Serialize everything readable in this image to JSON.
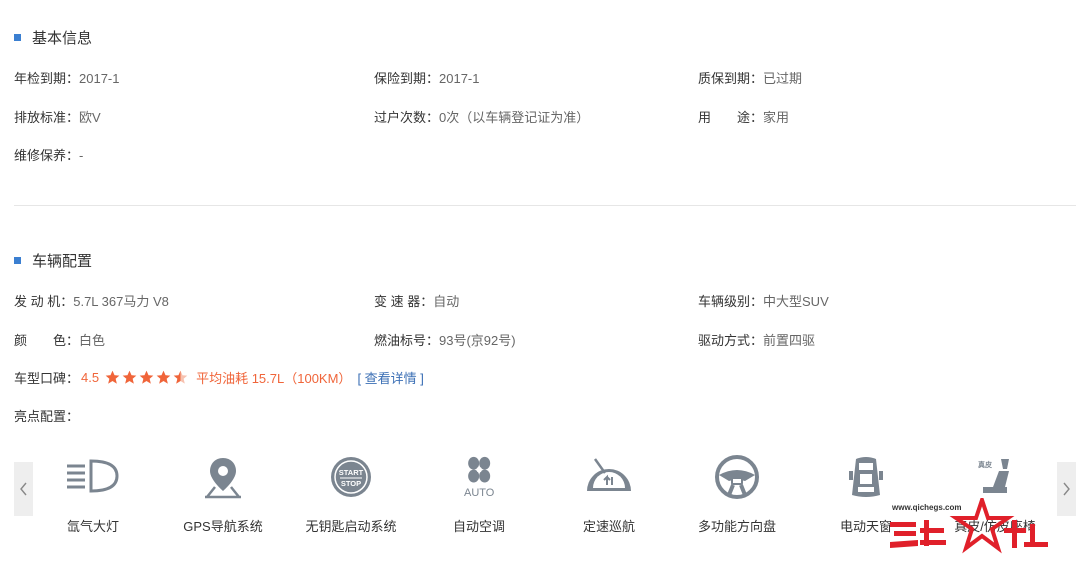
{
  "basic_info": {
    "title": "基本信息",
    "rows": [
      [
        {
          "label": "年检到期：",
          "value": "2017-1"
        },
        {
          "label": "保险到期：",
          "value": "2017-1"
        },
        {
          "label": "质保到期：",
          "value": "已过期"
        }
      ],
      [
        {
          "label": "排放标准：",
          "value": "欧V"
        },
        {
          "label": "过户次数：",
          "value": "0次（以车辆登记证为准）"
        },
        {
          "label": "用　　途：",
          "value": "家用"
        }
      ],
      [
        {
          "label": "维修保养：",
          "value": "-"
        }
      ]
    ]
  },
  "vehicle_config": {
    "title": "车辆配置",
    "rows": [
      [
        {
          "label": "发 动 机：",
          "value": "5.7L 367马力 V8"
        },
        {
          "label": "变 速 器：",
          "value": "自动"
        },
        {
          "label": "车辆级别：",
          "value": "中大型SUV"
        }
      ],
      [
        {
          "label": "颜　　色：",
          "value": "白色"
        },
        {
          "label": "燃油标号：",
          "value": "93号(京92号)"
        },
        {
          "label": "驱动方式：",
          "value": "前置四驱"
        }
      ]
    ],
    "rating": {
      "label": "车型口碑：",
      "score": "4.5",
      "stars": 4.5,
      "fuel": "平均油耗 15.7L（100KM）",
      "detail_link": "[ 查看详情 ]"
    },
    "highlights_label": "亮点配置：",
    "highlights": [
      {
        "name": "氙气大灯",
        "icon": "headlight-icon"
      },
      {
        "name": "GPS导航系统",
        "icon": "gps-pin-icon"
      },
      {
        "name": "无钥匙启动系统",
        "icon": "start-stop-button-icon",
        "icon_text_1": "START",
        "icon_text_2": "STOP"
      },
      {
        "name": "自动空调",
        "icon": "fan-auto-icon",
        "icon_text": "AUTO"
      },
      {
        "name": "定速巡航",
        "icon": "cruise-gauge-icon"
      },
      {
        "name": "多功能方向盘",
        "icon": "steering-wheel-icon"
      },
      {
        "name": "电动天窗",
        "icon": "car-sunroof-icon"
      },
      {
        "name": "真皮/仿皮座椅",
        "icon": "leather-seat-icon",
        "icon_text": "真皮"
      }
    ]
  },
  "watermark": {
    "url": "www.qichegs.com",
    "logo_text": "汽车之杜"
  },
  "colors": {
    "accent_blue": "#3b7fd1",
    "rating_orange": "#f0653a",
    "icon_gray": "#7b8590",
    "watermark_red": "#e0202a"
  }
}
